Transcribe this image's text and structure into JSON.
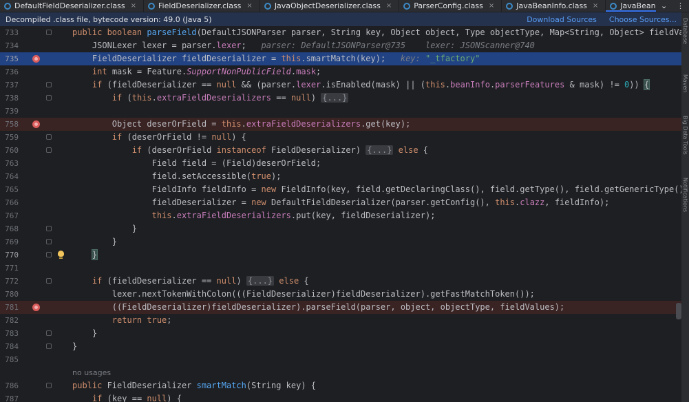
{
  "tabs": [
    {
      "label": "DefaultFieldDeserializer.class",
      "active": false
    },
    {
      "label": "FieldDeserializer.class",
      "active": false
    },
    {
      "label": "JavaObjectDeserializer.class",
      "active": false
    },
    {
      "label": "ParserConfig.class",
      "active": false
    },
    {
      "label": "JavaBeanInfo.class",
      "active": false
    },
    {
      "label": "JavaBeanDeserializer.class",
      "active": true
    }
  ],
  "tab_close_glyph": "×",
  "tabbar_more_glyph": "⌄",
  "tabbar_menu_glyph": "⋮",
  "infobar": {
    "message": "Decompiled .class file, bytecode version: 49.0 (Java 5)",
    "download_sources": "Download Sources",
    "choose_sources": "Choose Sources..."
  },
  "right_strip": [
    "Database",
    "Maven",
    "Big Data Tools",
    "Notifications"
  ],
  "lines": {
    "l733": {
      "num": "733"
    },
    "l734": {
      "num": "734",
      "hint1": "parser: DefaultJSONParser@735",
      "hint2": "lexer: JSONScanner@740"
    },
    "l735": {
      "num": "735",
      "hint": "key: ",
      "str": "\"_tfactory\""
    },
    "l736": {
      "num": "736"
    },
    "l737": {
      "num": "737",
      "zero": "0"
    },
    "l738": {
      "num": "738",
      "folded": "{...}"
    },
    "l739": {
      "num": "739"
    },
    "l758": {
      "num": "758"
    },
    "l759": {
      "num": "759"
    },
    "l760": {
      "num": "760",
      "folded": "{...}"
    },
    "l763": {
      "num": "763"
    },
    "l764": {
      "num": "764"
    },
    "l765": {
      "num": "765"
    },
    "l766": {
      "num": "766"
    },
    "l767": {
      "num": "767"
    },
    "l768": {
      "num": "768"
    },
    "l769": {
      "num": "769"
    },
    "l770": {
      "num": "770"
    },
    "l771": {
      "num": "771"
    },
    "l772": {
      "num": "772",
      "folded": "{...}"
    },
    "l780": {
      "num": "780"
    },
    "l781": {
      "num": "781"
    },
    "l782": {
      "num": "782"
    },
    "l783": {
      "num": "783"
    },
    "l784": {
      "num": "784"
    },
    "l785": {
      "num": "785"
    },
    "usages": "no usages",
    "l786": {
      "num": "786"
    },
    "l787": {
      "num": "787"
    }
  },
  "colors": {
    "background": "#1e1f22",
    "highlight_line": "#214283",
    "breakpoint": "#db5c5c",
    "keyword": "#cf8e6d",
    "function": "#56a8f5",
    "field": "#c77dbb",
    "string": "#6aab73",
    "link": "#589df6"
  }
}
